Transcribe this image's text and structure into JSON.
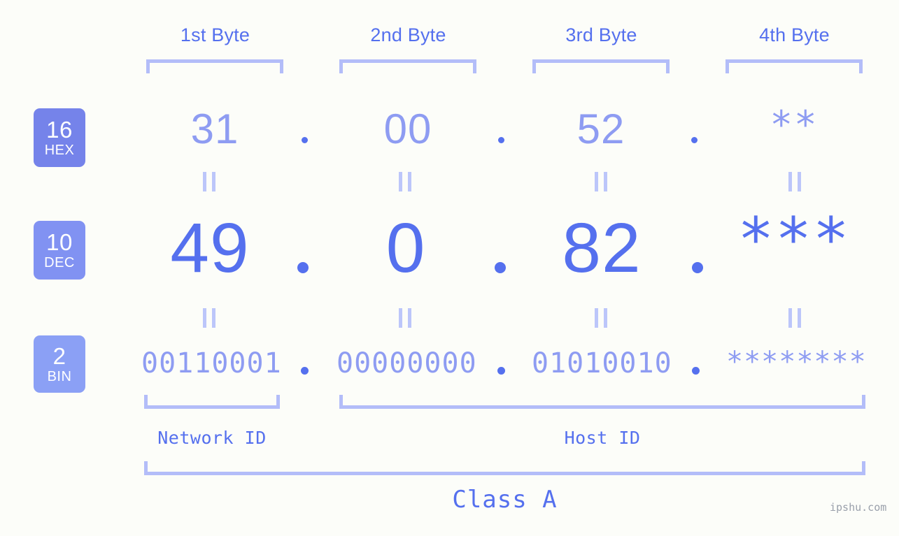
{
  "background_color": "#fcfdf9",
  "accent_color": "#5570ee",
  "muted_accent_color": "#8e9cf2",
  "bracket_color": "#b3bdf9",
  "headers": {
    "byte1": "1st Byte",
    "byte2": "2nd Byte",
    "byte3": "3rd Byte",
    "byte4": "4th Byte"
  },
  "radix_badges": [
    {
      "number": "16",
      "abbr": "HEX",
      "color": "#7583ea"
    },
    {
      "number": "10",
      "abbr": "DEC",
      "color": "#8192f2"
    },
    {
      "number": "2",
      "abbr": "BIN",
      "color": "#8ba0f5"
    }
  ],
  "rows": {
    "hex": {
      "label": "HEX",
      "values": [
        "31",
        "00",
        "52",
        "**"
      ],
      "separator": "."
    },
    "dec": {
      "label": "DEC",
      "values": [
        "49",
        "0",
        "82",
        "***"
      ],
      "separator": "."
    },
    "bin": {
      "label": "BIN",
      "values": [
        "00110001",
        "00000000",
        "01010010",
        "********"
      ],
      "separator": "."
    }
  },
  "equality_mark": "=",
  "sections": {
    "network_id": "Network ID",
    "host_id": "Host ID",
    "class": "Class A"
  },
  "watermark": "ipshu.com"
}
